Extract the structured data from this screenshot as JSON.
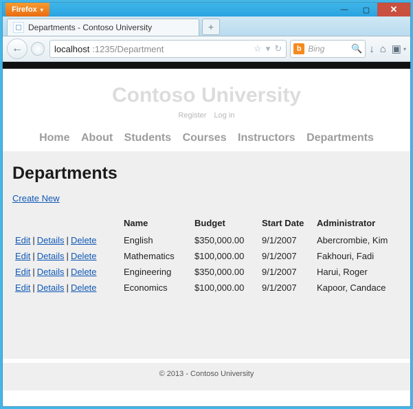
{
  "window": {
    "app_button": "Firefox",
    "min_glyph": "—",
    "max_glyph": "▢",
    "close_glyph": "✕"
  },
  "tab": {
    "title": "Departments - Contoso University",
    "newtab_glyph": "+"
  },
  "nav": {
    "back_glyph": "←",
    "url_host": "localhost",
    "url_port_path": ":1235/Department",
    "star_glyph": "☆",
    "dropdown_glyph": "▾",
    "reload_glyph": "↻",
    "search_engine_glyph": "b",
    "search_placeholder": "Bing",
    "search_mag_glyph": "🔍",
    "download_glyph": "↓",
    "home_glyph": "⌂",
    "bookmark_glyph": "▣"
  },
  "site": {
    "title": "Contoso University",
    "register": "Register",
    "login": "Log in",
    "menu": [
      "Home",
      "About",
      "Students",
      "Courses",
      "Instructors",
      "Departments"
    ]
  },
  "page": {
    "heading": "Departments",
    "create_label": "Create New",
    "columns": {
      "c0": "",
      "c1": "Name",
      "c2": "Budget",
      "c3": "Start Date",
      "c4": "Administrator"
    },
    "actions": {
      "edit": "Edit",
      "details": "Details",
      "del": "Delete",
      "sep": "|"
    },
    "rows": [
      {
        "name": "English",
        "budget": "$350,000.00",
        "start": "9/1/2007",
        "admin": "Abercrombie, Kim"
      },
      {
        "name": "Mathematics",
        "budget": "$100,000.00",
        "start": "9/1/2007",
        "admin": "Fakhouri, Fadi"
      },
      {
        "name": "Engineering",
        "budget": "$350,000.00",
        "start": "9/1/2007",
        "admin": "Harui, Roger"
      },
      {
        "name": "Economics",
        "budget": "$100,000.00",
        "start": "9/1/2007",
        "admin": "Kapoor, Candace"
      }
    ]
  },
  "footer": "© 2013 - Contoso University"
}
